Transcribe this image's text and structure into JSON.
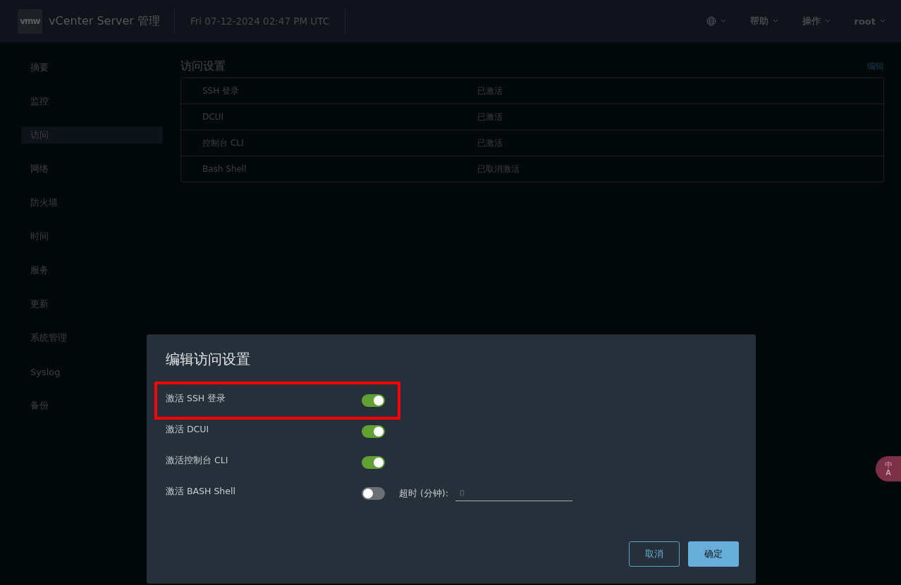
{
  "header": {
    "logo": "vmw",
    "title": "vCenter Server 管理",
    "datetime": "Fri 07-12-2024 02:47 PM UTC",
    "menus": [
      {
        "kind": "globe"
      },
      {
        "kind": "text",
        "label": "帮助"
      },
      {
        "kind": "text",
        "label": "操作"
      },
      {
        "kind": "text",
        "label": "root"
      }
    ]
  },
  "sidebar": {
    "items": [
      {
        "label": "摘要",
        "selected": false
      },
      {
        "label": "监控",
        "selected": false
      },
      {
        "label": "访问",
        "selected": true
      },
      {
        "label": "网络",
        "selected": false
      },
      {
        "label": "防火墙",
        "selected": false
      },
      {
        "label": "时间",
        "selected": false
      },
      {
        "label": "服务",
        "selected": false
      },
      {
        "label": "更新",
        "selected": false
      },
      {
        "label": "系统管理",
        "selected": false
      },
      {
        "label": "Syslog",
        "selected": false
      },
      {
        "label": "备份",
        "selected": false
      }
    ]
  },
  "access_settings": {
    "title": "访问设置",
    "edit_link": "编辑",
    "rows": [
      {
        "name": "SSH 登录",
        "status": "已激活"
      },
      {
        "name": "DCUI",
        "status": "已激活"
      },
      {
        "name": "控制台 CLI",
        "status": "已激活"
      },
      {
        "name": "Bash Shell",
        "status": "已取消激活"
      }
    ]
  },
  "dialog": {
    "title": "编辑访问设置",
    "options": [
      {
        "label": "激活 SSH 登录",
        "on": true,
        "highlighted": true
      },
      {
        "label": "激活 DCUI",
        "on": true,
        "highlighted": false
      },
      {
        "label": "激活控制台 CLI",
        "on": true,
        "highlighted": false
      },
      {
        "label": "激活 BASH Shell",
        "on": false,
        "highlighted": false,
        "timeout_label": "超时 (分钟):",
        "timeout_placeholder": "0"
      }
    ],
    "buttons": [
      {
        "kind": "secondary",
        "label": "取消"
      },
      {
        "kind": "primary",
        "label": "确定"
      }
    ]
  },
  "translate_button": {
    "label_top": "中",
    "label_bottom": "A"
  }
}
